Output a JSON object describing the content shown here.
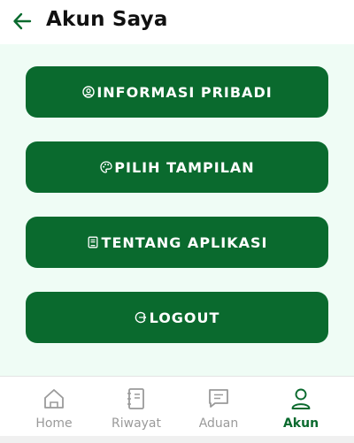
{
  "header": {
    "title": "Akun Saya",
    "back_icon": "arrow-left-icon"
  },
  "menu": [
    {
      "label": "INFORMASI PRIBADI",
      "icon": "user-circle-icon"
    },
    {
      "label": "PILIH TAMPILAN",
      "icon": "palette-icon"
    },
    {
      "label": "TENTANG APLIKASI",
      "icon": "book-icon"
    },
    {
      "label": "LOGOUT",
      "icon": "logout-icon"
    }
  ],
  "bottom_nav": [
    {
      "label": "Home",
      "icon": "home-icon",
      "active": false
    },
    {
      "label": "Riwayat",
      "icon": "notebook-icon",
      "active": false
    },
    {
      "label": "Aduan",
      "icon": "chat-icon",
      "active": false
    },
    {
      "label": "Akun",
      "icon": "person-icon",
      "active": true
    }
  ],
  "colors": {
    "primary": "#0a6a2e",
    "content_bg": "#effcf5",
    "inactive": "#9a9a9a"
  }
}
